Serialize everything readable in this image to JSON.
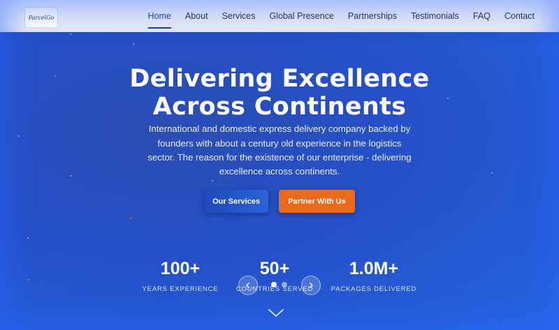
{
  "brand": {
    "logo_text": "ParcelGo"
  },
  "nav": {
    "items": [
      {
        "label": "Home",
        "active": true
      },
      {
        "label": "About"
      },
      {
        "label": "Services"
      },
      {
        "label": "Global Presence"
      },
      {
        "label": "Partnerships"
      },
      {
        "label": "Testimonials"
      },
      {
        "label": "FAQ"
      },
      {
        "label": "Contact"
      }
    ]
  },
  "hero": {
    "title_line1": "Delivering Excellence",
    "title_line2": "Across Continents",
    "description": "International and domestic express delivery company backed by founders with about a century old experience in the logistics sector. The reason for the existence of our enterprise - delivering excellence across continents.",
    "primary_button": "Our Services",
    "secondary_button": "Partner With Us"
  },
  "stats": [
    {
      "value": "100+",
      "label": "YEARS EXPERIENCE"
    },
    {
      "value": "50+",
      "label": "COUNTRIES SERVED"
    },
    {
      "value": "1.0M+",
      "label": "PACKAGES DELIVERED"
    }
  ],
  "carousel": {
    "prev_icon": "chevron-left-icon",
    "next_icon": "chevron-right-icon",
    "slide_count": 2,
    "active_slide": 1
  },
  "scroll_icon": "chevron-down-icon",
  "colors": {
    "primary": "#1c3fa8",
    "accent": "#ea6a1c",
    "hero_bg": "#2550c9"
  }
}
